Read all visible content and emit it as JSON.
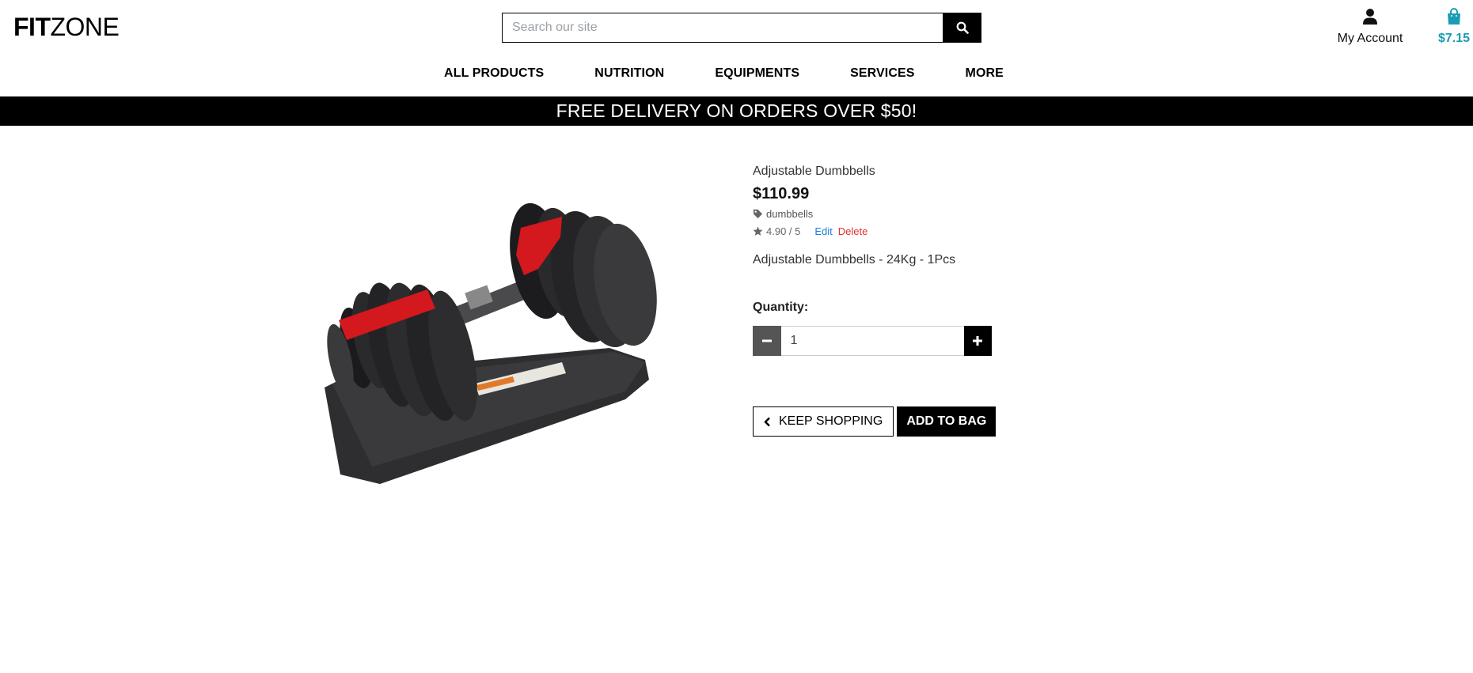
{
  "header": {
    "logo_bold": "FIT",
    "logo_light": "ZONE",
    "search_placeholder": "Search our site",
    "account_label": "My Account",
    "bag_total": "$7.15"
  },
  "nav": {
    "items": [
      "ALL PRODUCTS",
      "NUTRITION",
      "EQUIPMENTS",
      "SERVICES",
      "MORE"
    ]
  },
  "banner": {
    "text": "FREE DELIVERY ON ORDERS OVER $50!"
  },
  "product": {
    "name": "Adjustable Dumbbells",
    "price": "$110.99",
    "category": "dumbbells",
    "rating": "4.90 / 5",
    "edit_label": "Edit",
    "delete_label": "Delete",
    "description": "Adjustable Dumbbells - 24Kg - 1Pcs",
    "quantity_label": "Quantity:",
    "quantity_value": "1",
    "keep_shopping_label": "KEEP SHOPPING",
    "add_to_bag_label": "ADD TO BAG"
  },
  "colors": {
    "accent": "#1a9db3",
    "banner_bg": "#000000",
    "edit_link": "#1a7fe0",
    "delete_link": "#e03030"
  },
  "icons": {
    "search": "search-icon",
    "account": "user-icon",
    "bag": "shopping-bag-icon",
    "tag": "tag-icon",
    "star": "star-icon",
    "minus": "minus-icon",
    "plus": "plus-icon",
    "chevron": "chevron-left-icon"
  }
}
